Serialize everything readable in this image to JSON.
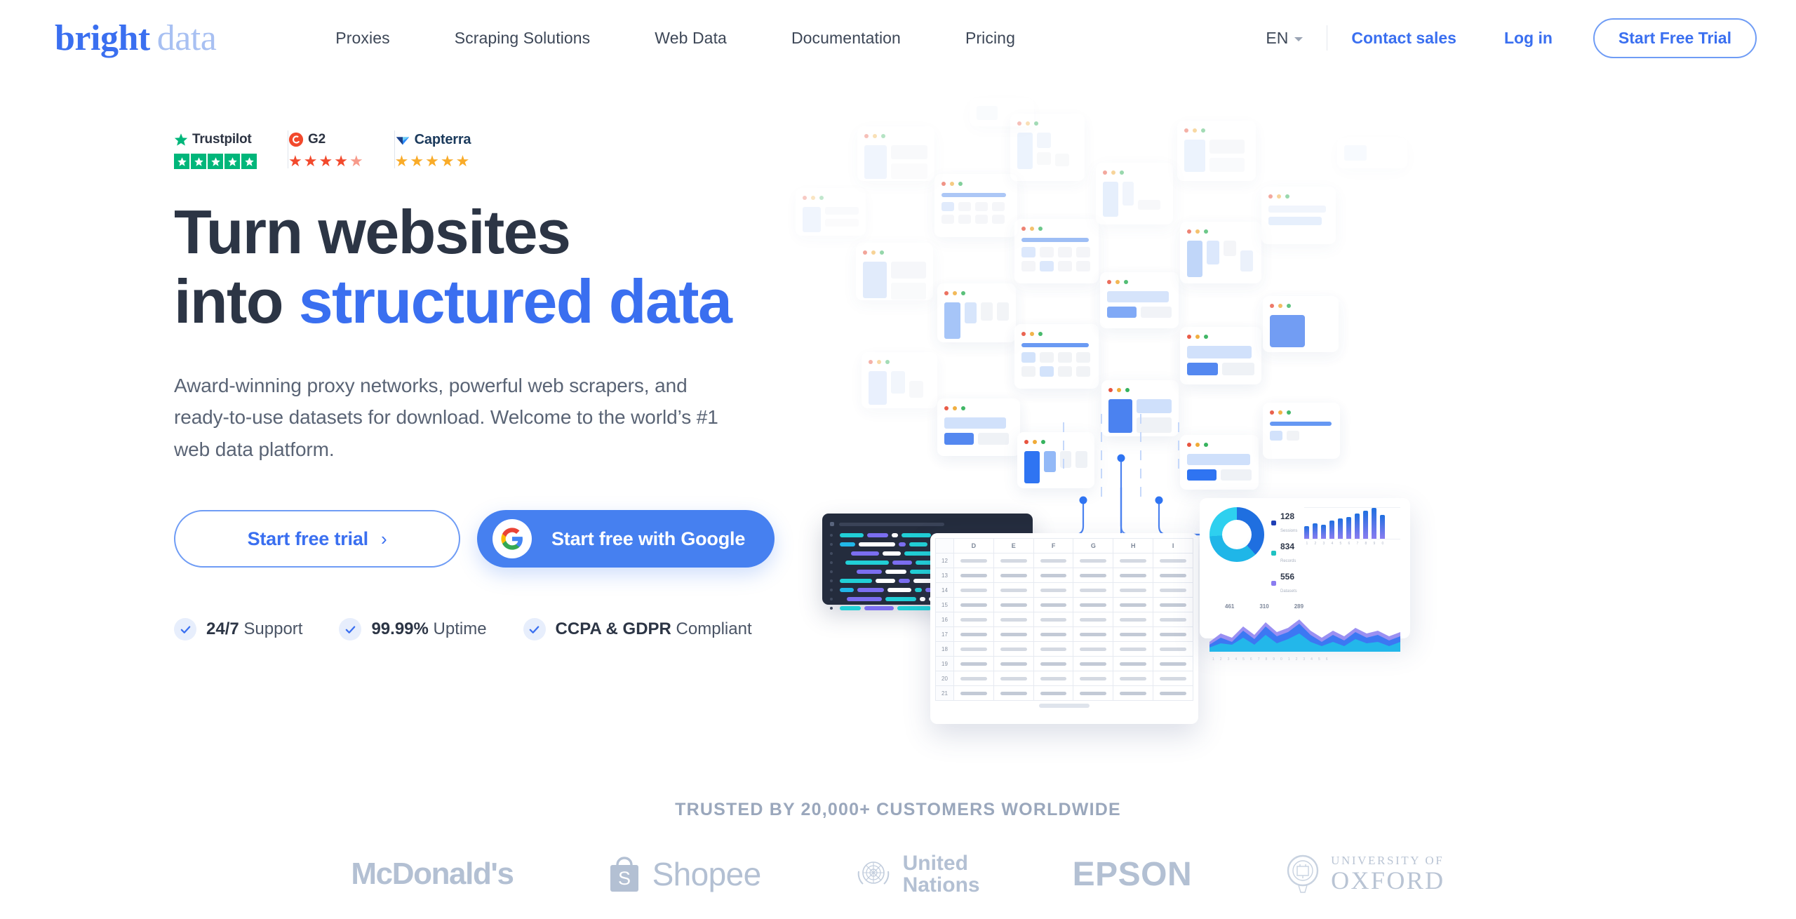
{
  "header": {
    "logo": {
      "part1": "bright",
      "part2": "data"
    },
    "nav": [
      {
        "label": "Proxies"
      },
      {
        "label": "Scraping Solutions"
      },
      {
        "label": "Web Data"
      },
      {
        "label": "Documentation"
      },
      {
        "label": "Pricing"
      }
    ],
    "language": "EN",
    "contact_sales": "Contact sales",
    "log_in": "Log in",
    "start_free_trial": "Start Free Trial"
  },
  "hero": {
    "badges": [
      {
        "name": "Trustpilot",
        "icon": "trustpilot-star-icon",
        "rating": 5,
        "color": "#00b67a"
      },
      {
        "name": "G2",
        "icon": "g2-logo-icon",
        "rating": 4.5,
        "color": "#f2492c"
      },
      {
        "name": "Capterra",
        "icon": "capterra-logo-icon",
        "rating": 5,
        "color": "#f9ab28"
      }
    ],
    "headline_line1": "Turn websites",
    "headline_line2_plain": "into ",
    "headline_line2_accent": "structured data",
    "subcopy": "Award-winning proxy networks, powerful web scrapers, and ready-to-use datasets for download. Welcome to the world’s #1 web data platform.",
    "cta_primary": "Start free trial",
    "cta_primary_arrow": "›",
    "cta_google": "Start free with Google",
    "features": [
      {
        "bold": "24/7",
        "rest": " Support"
      },
      {
        "bold": "99.99%",
        "rest": " Uptime"
      },
      {
        "bold": "CCPA & GDPR",
        "rest": " Compliant"
      }
    ],
    "accent_color": "#3a6ff0",
    "heading_color": "#2c3545"
  },
  "illustration": {
    "spreadsheet": {
      "columns": [
        "D",
        "E",
        "F",
        "G",
        "H",
        "I"
      ],
      "rows": [
        "12",
        "13",
        "14",
        "15",
        "16",
        "17",
        "18",
        "19",
        "20",
        "21"
      ]
    },
    "dashboard": {
      "legend": [
        {
          "value": "128",
          "caption": "Sessions",
          "color": "#1f3fb5"
        },
        {
          "value": "834",
          "caption": "Records",
          "color": "#1fc2c2"
        },
        {
          "value": "556",
          "caption": "Datasets",
          "color": "#8a7cf0"
        }
      ],
      "bar_values": [
        18,
        22,
        20,
        26,
        29,
        31,
        36,
        40,
        44,
        34
      ],
      "bar_axis": [
        "1",
        "2",
        "3",
        "4",
        "5",
        "6",
        "7",
        "8",
        "9",
        "0"
      ],
      "area_labels": [
        "461",
        "310",
        "289"
      ]
    }
  },
  "trusted": {
    "title": "TRUSTED BY 20,000+ CUSTOMERS WORLDWIDE",
    "logos": [
      {
        "name": "McDonald's"
      },
      {
        "name": "Shopee"
      },
      {
        "name": "United",
        "name2": "Nations"
      },
      {
        "name": "EPSON"
      },
      {
        "name": "UNIVERSITY OF",
        "name2": "OXFORD"
      }
    ]
  }
}
